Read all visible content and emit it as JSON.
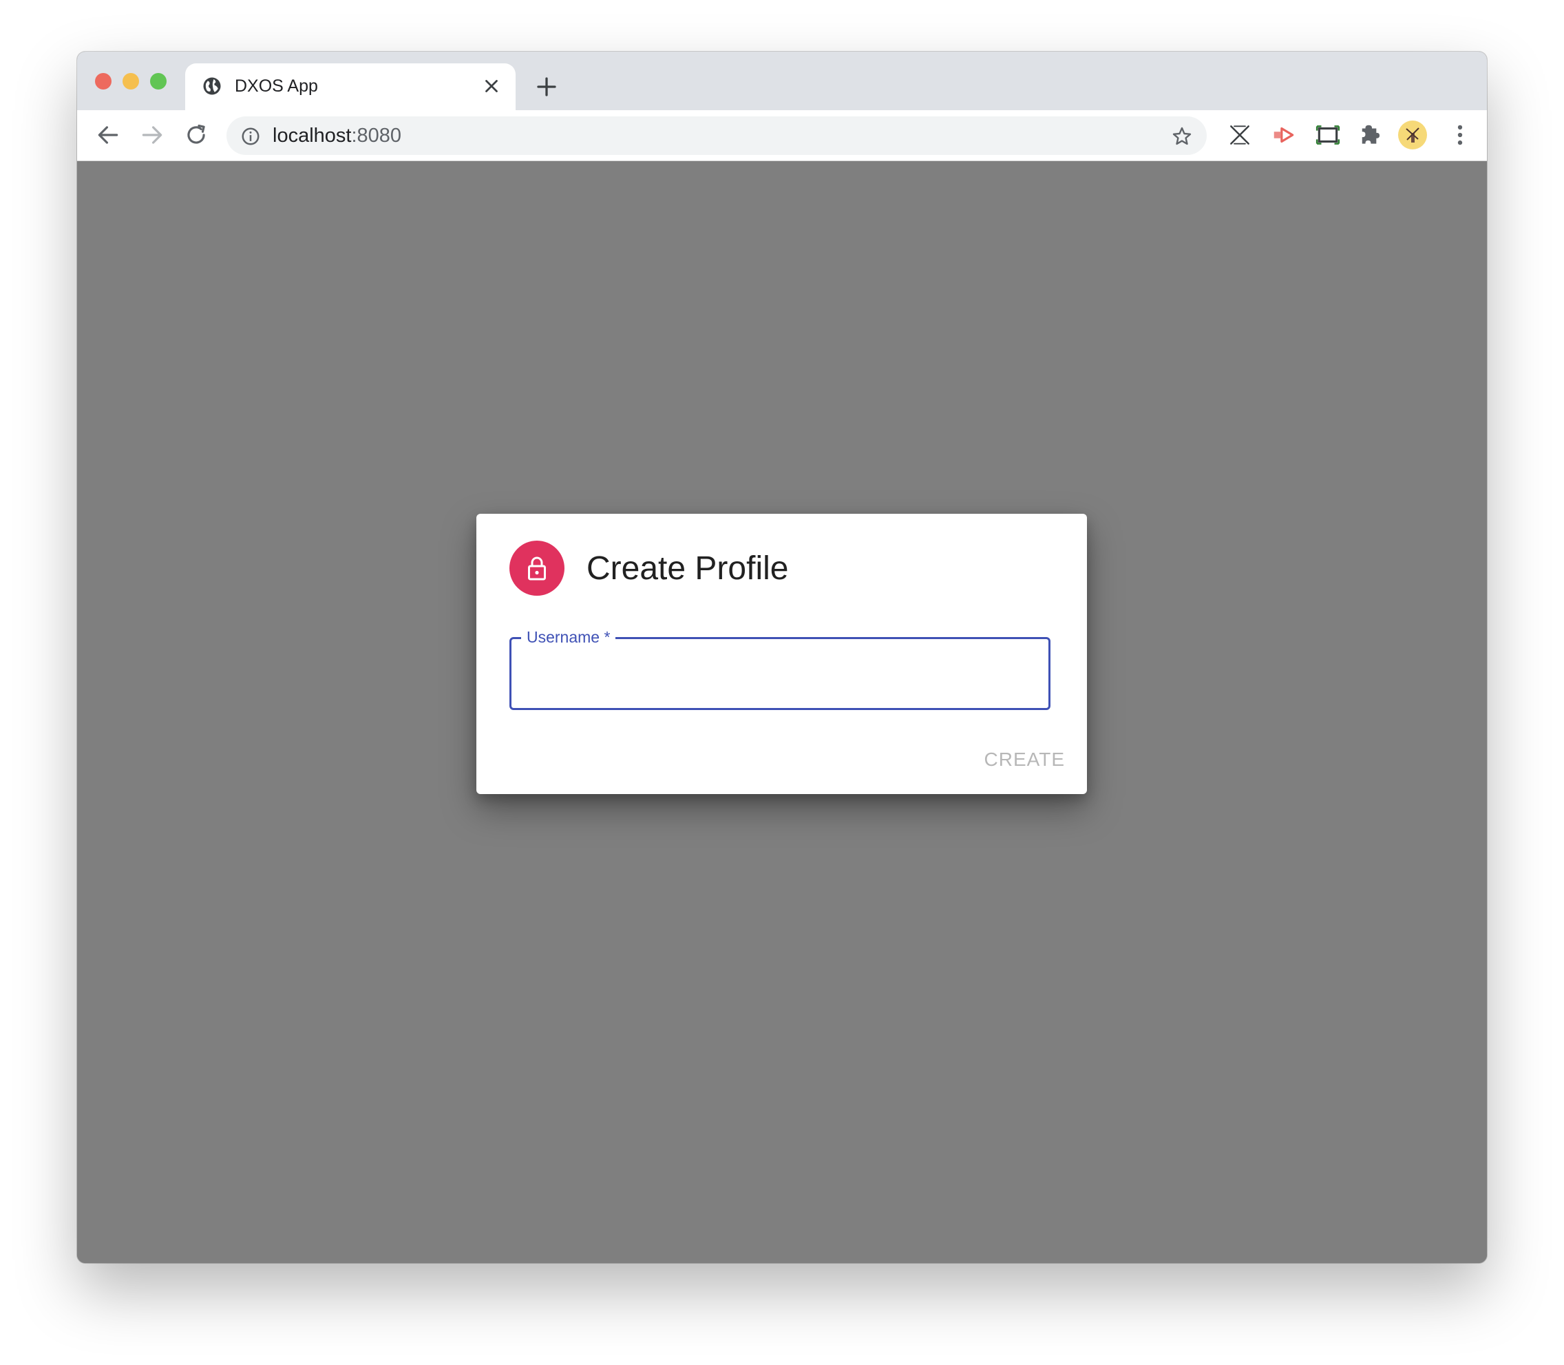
{
  "window": {
    "traffic_lights": {
      "close_color": "#ed6a5e",
      "minimize_color": "#f5bf4f",
      "maximize_color": "#61c554"
    }
  },
  "tab": {
    "title": "DXOS App",
    "icon": "globe-icon"
  },
  "toolbar": {
    "url_host": "localhost",
    "url_port": ":8080",
    "icons": [
      "back-arrow-icon",
      "forward-arrow-icon",
      "reload-icon",
      "info-icon",
      "bookmark-star-icon",
      "extension-x-icon",
      "extension-arrow-icon",
      "screenshot-icon",
      "puzzle-icon",
      "profile-avatar",
      "more-vert-icon"
    ]
  },
  "dialog": {
    "title": "Create Profile",
    "field_label": "Username *",
    "field_value": "",
    "create_label": "CREATE",
    "accent_color": "#3f51b5",
    "avatar_color": "#e0325e"
  }
}
